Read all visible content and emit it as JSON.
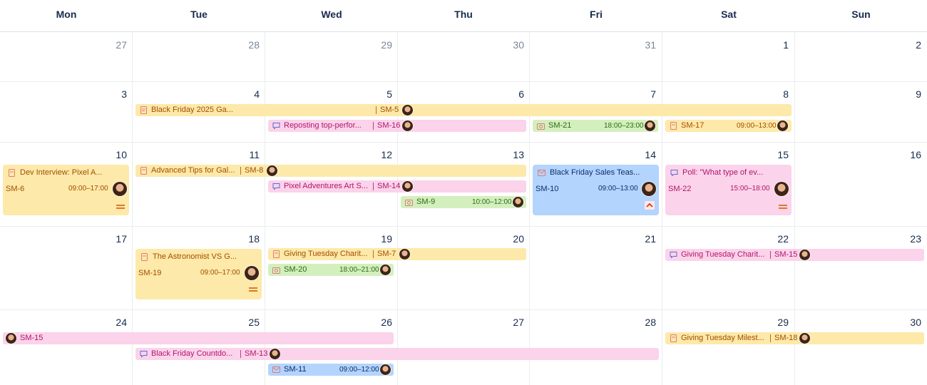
{
  "calendar": {
    "weekdays": [
      "Mon",
      "Tue",
      "Wed",
      "Thu",
      "Fri",
      "Sat",
      "Sun"
    ],
    "weeks": [
      [
        "27",
        "28",
        "29",
        "30",
        "31",
        "1",
        "2"
      ],
      [
        "3",
        "4",
        "5",
        "6",
        "7",
        "8",
        "9"
      ],
      [
        "10",
        "11",
        "12",
        "13",
        "14",
        "15",
        "16"
      ],
      [
        "17",
        "18",
        "19",
        "20",
        "21",
        "22",
        "23"
      ],
      [
        "24",
        "25",
        "26",
        "27",
        "28",
        "29",
        "30"
      ]
    ]
  },
  "colors": {
    "yellow": "#fde9a9",
    "pink": "#fbd3ea",
    "green": "#d3efbe",
    "blue": "#b3d4fd"
  },
  "events": {
    "bf2025": {
      "title": "Black Friday 2025 Ga...",
      "key": "SM-5",
      "icon": "document-icon"
    },
    "reposting": {
      "title": "Reposting top-perfor...",
      "key": "SM-16",
      "icon": "comment-icon"
    },
    "sm21": {
      "key": "SM-21",
      "time": "18:00–23:00",
      "icon": "camera-icon"
    },
    "sm17": {
      "key": "SM-17",
      "time": "09:00–13:00",
      "icon": "document-icon"
    },
    "devinterview": {
      "title": "Dev Interview: Pixel A...",
      "key": "SM-6",
      "time": "09:00–17:00",
      "icon": "document-icon",
      "priority": "medium-priority-icon"
    },
    "advtips": {
      "title": "Advanced Tips for Gal...",
      "key": "SM-8",
      "icon": "document-icon"
    },
    "bfteaser": {
      "title": "Black Friday Sales Teas...",
      "key": "SM-10",
      "time": "09:00–13:00",
      "icon": "mail-icon",
      "priority": "high-priority-icon"
    },
    "poll": {
      "title": "Poll: \"What type of ev...",
      "key": "SM-22",
      "time": "15:00–18:00",
      "icon": "comment-icon",
      "priority": "medium-priority-icon"
    },
    "pixelart": {
      "title": "Pixel Adventures Art S...",
      "key": "SM-14",
      "icon": "comment-icon"
    },
    "sm9": {
      "key": "SM-9",
      "time": "10:00–12:00",
      "icon": "camera-icon"
    },
    "astronomist": {
      "title": "The Astronomist VS G...",
      "key": "SM-19",
      "time": "09:00–17:00",
      "icon": "document-icon",
      "priority": "medium-priority-icon"
    },
    "givingtue7": {
      "title": "Giving Tuesday Charit...",
      "key": "SM-7",
      "icon": "document-icon"
    },
    "sm20": {
      "key": "SM-20",
      "time": "18:00–21:00",
      "icon": "camera-icon"
    },
    "givingtue15": {
      "title": "Giving Tuesday Charit...",
      "key": "SM-15",
      "icon": "comment-icon"
    },
    "sm15cont": {
      "key": "SM-15"
    },
    "bfcountdown": {
      "title": "Black Friday Countdo...",
      "key": "SM-13",
      "icon": "comment-icon"
    },
    "sm11": {
      "key": "SM-11",
      "time": "09:00–12:00",
      "icon": "mail-icon"
    },
    "givingmilestone": {
      "title": "Giving Tuesday Milest...",
      "key": "SM-18",
      "icon": "document-icon"
    }
  }
}
